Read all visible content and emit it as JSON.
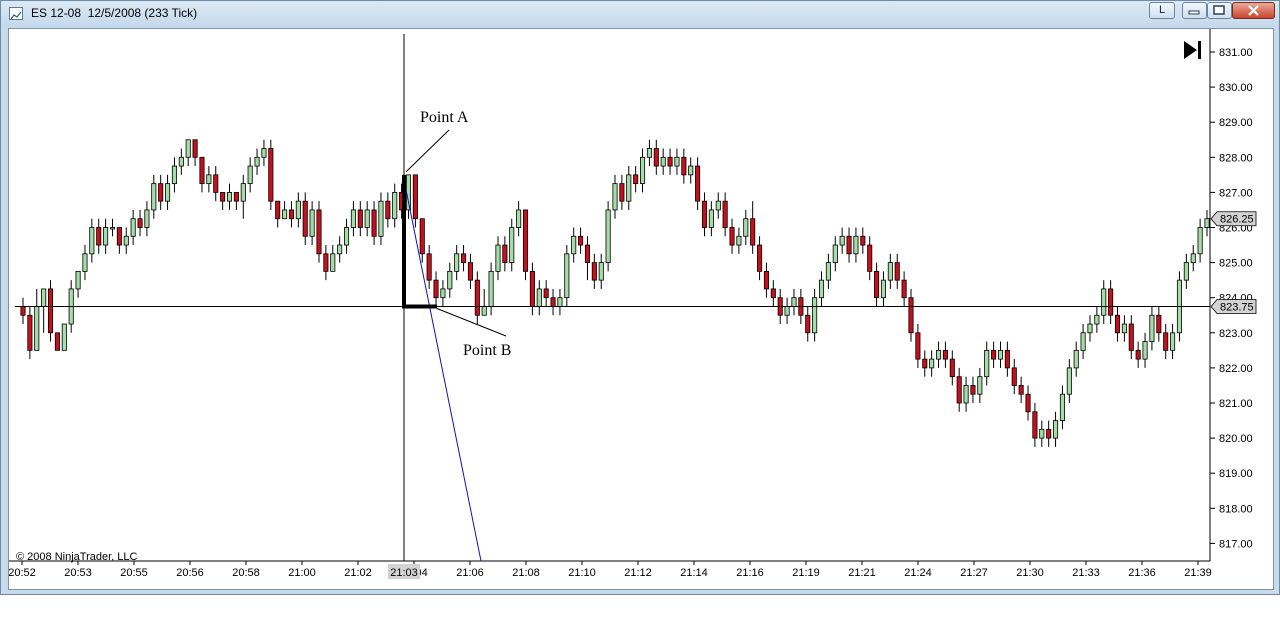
{
  "window": {
    "title": "ES 12-08  12/5/2008 (233 Tick)",
    "minimize_label": "L",
    "icons": [
      "chart-app-icon",
      "minimize-icon",
      "maximize-icon",
      "close-icon"
    ]
  },
  "chart": {
    "copyright": "© 2008 NinjaTrader, LLC",
    "scroll_end_icon": "skip-to-end-icon",
    "price_ticks": [
      "831.00",
      "830.00",
      "829.00",
      "828.00",
      "827.00",
      "826.00",
      "825.00",
      "824.00",
      "823.00",
      "822.00",
      "821.00",
      "820.00",
      "819.00",
      "818.00",
      "817.00"
    ],
    "time_ticks": [
      "20:52",
      "20:53",
      "20:55",
      "20:56",
      "20:58",
      "21:00",
      "21:02",
      "21:04",
      "21:06",
      "21:08",
      "21:10",
      "21:12",
      "21:14",
      "21:16",
      "21:19",
      "21:21",
      "21:24",
      "21:27",
      "21:30",
      "21:33",
      "21:36",
      "21:39"
    ],
    "last_price_label": "826.25",
    "crosshair_price_label": "823.75",
    "crosshair_time_label": "21:03",
    "annotations": {
      "point_a": "Point A",
      "point_b": "Point B"
    },
    "colors": {
      "up": "#a6dca6",
      "down": "#c8101c",
      "trendline": "#1010c0",
      "annotation_line": "#000000"
    }
  },
  "chart_data": {
    "type": "candlestick",
    "instrument": "ES 12-08",
    "ylim": [
      816.6,
      831.4
    ],
    "candles": [
      [
        823.75,
        823.5,
        824.0,
        823.25
      ],
      [
        823.5,
        822.5,
        823.75,
        822.25
      ],
      [
        822.5,
        823.75,
        824.25,
        822.5
      ],
      [
        823.75,
        824.25,
        824.25,
        823.0
      ],
      [
        824.25,
        823.0,
        824.5,
        822.75
      ],
      [
        823.0,
        822.5,
        823.0,
        822.5
      ],
      [
        822.5,
        823.25,
        823.25,
        822.5
      ],
      [
        823.25,
        824.25,
        824.5,
        823.0
      ],
      [
        824.25,
        824.75,
        824.75,
        824.0
      ],
      [
        824.75,
        825.25,
        825.5,
        824.5
      ],
      [
        825.25,
        826.0,
        826.25,
        825.0
      ],
      [
        826.0,
        825.5,
        826.25,
        825.25
      ],
      [
        825.5,
        826.0,
        826.25,
        825.25
      ],
      [
        826.0,
        826.0,
        826.25,
        825.75
      ],
      [
        826.0,
        825.5,
        826.0,
        825.25
      ],
      [
        825.5,
        825.75,
        826.0,
        825.25
      ],
      [
        825.75,
        826.25,
        826.5,
        825.5
      ],
      [
        826.25,
        826.0,
        826.5,
        825.75
      ],
      [
        826.0,
        826.5,
        826.75,
        825.75
      ],
      [
        826.5,
        827.25,
        827.5,
        826.25
      ],
      [
        827.25,
        826.75,
        827.5,
        826.5
      ],
      [
        826.75,
        827.25,
        827.5,
        826.5
      ],
      [
        827.25,
        827.75,
        828.0,
        827.0
      ],
      [
        827.75,
        828.0,
        828.25,
        827.5
      ],
      [
        828.0,
        828.5,
        828.5,
        827.75
      ],
      [
        828.5,
        828.0,
        828.5,
        827.75
      ],
      [
        828.0,
        827.25,
        828.0,
        827.0
      ],
      [
        827.25,
        827.5,
        827.75,
        827.0
      ],
      [
        827.5,
        827.0,
        827.75,
        826.75
      ],
      [
        827.0,
        826.75,
        827.0,
        826.5
      ],
      [
        826.75,
        827.0,
        827.25,
        826.5
      ],
      [
        827.0,
        826.75,
        827.0,
        826.5
      ],
      [
        826.75,
        827.25,
        827.5,
        826.25
      ],
      [
        827.25,
        827.75,
        828.0,
        827.0
      ],
      [
        827.75,
        828.0,
        828.25,
        827.5
      ],
      [
        828.0,
        828.25,
        828.5,
        827.75
      ],
      [
        828.25,
        826.75,
        828.5,
        826.5
      ],
      [
        826.75,
        826.25,
        826.75,
        826.0
      ],
      [
        826.25,
        826.5,
        826.75,
        826.25
      ],
      [
        826.5,
        826.25,
        826.75,
        826.0
      ],
      [
        826.25,
        826.75,
        827.0,
        826.0
      ],
      [
        826.75,
        825.75,
        827.0,
        825.5
      ],
      [
        825.75,
        826.5,
        826.75,
        825.5
      ],
      [
        826.5,
        825.25,
        826.75,
        825.0
      ],
      [
        825.25,
        824.75,
        825.5,
        824.5
      ],
      [
        824.75,
        825.25,
        825.5,
        824.75
      ],
      [
        825.25,
        825.5,
        825.75,
        825.0
      ],
      [
        825.5,
        826.0,
        826.25,
        825.25
      ],
      [
        826.0,
        826.5,
        826.75,
        825.75
      ],
      [
        826.5,
        826.0,
        826.75,
        825.75
      ],
      [
        826.0,
        826.5,
        826.75,
        825.75
      ],
      [
        826.5,
        825.75,
        826.75,
        825.5
      ],
      [
        825.75,
        826.75,
        827.0,
        825.5
      ],
      [
        826.75,
        826.25,
        827.0,
        826.0
      ],
      [
        826.25,
        827.0,
        827.25,
        826.0
      ],
      [
        827.0,
        826.5,
        827.25,
        826.25
      ],
      [
        826.5,
        827.5,
        827.5,
        826.25
      ],
      [
        827.5,
        826.25,
        827.5,
        826.0
      ],
      [
        826.25,
        825.25,
        826.25,
        825.0
      ],
      [
        825.25,
        824.5,
        825.5,
        824.25
      ],
      [
        824.5,
        824.0,
        824.75,
        823.75
      ],
      [
        824.0,
        824.25,
        824.5,
        823.75
      ],
      [
        824.25,
        824.75,
        825.0,
        824.0
      ],
      [
        824.75,
        825.25,
        825.5,
        824.5
      ],
      [
        825.25,
        825.0,
        825.5,
        824.75
      ],
      [
        825.0,
        824.5,
        825.25,
        824.25
      ],
      [
        824.5,
        823.5,
        824.75,
        823.25
      ],
      [
        823.5,
        823.75,
        824.25,
        823.5
      ],
      [
        823.75,
        824.75,
        825.0,
        823.5
      ],
      [
        824.75,
        825.5,
        825.75,
        824.5
      ],
      [
        825.5,
        825.0,
        825.75,
        824.75
      ],
      [
        825.0,
        826.0,
        826.25,
        824.75
      ],
      [
        826.0,
        826.5,
        826.75,
        825.75
      ],
      [
        826.5,
        824.75,
        826.5,
        824.5
      ],
      [
        824.75,
        823.75,
        825.0,
        823.5
      ],
      [
        823.75,
        824.25,
        824.5,
        823.5
      ],
      [
        824.25,
        824.0,
        824.5,
        823.75
      ],
      [
        824.0,
        823.75,
        824.25,
        823.5
      ],
      [
        823.75,
        824.0,
        824.25,
        823.5
      ],
      [
        824.0,
        825.25,
        825.5,
        823.75
      ],
      [
        825.25,
        825.75,
        826.0,
        825.0
      ],
      [
        825.75,
        825.5,
        826.0,
        825.25
      ],
      [
        825.5,
        825.0,
        825.75,
        824.5
      ],
      [
        825.0,
        824.5,
        825.25,
        824.25
      ],
      [
        824.5,
        825.0,
        825.25,
        824.25
      ],
      [
        825.0,
        826.5,
        826.75,
        824.75
      ],
      [
        826.5,
        827.25,
        827.5,
        826.25
      ],
      [
        827.25,
        826.75,
        827.5,
        826.5
      ],
      [
        826.75,
        827.5,
        827.75,
        826.5
      ],
      [
        827.5,
        827.25,
        827.75,
        827.0
      ],
      [
        827.25,
        828.0,
        828.25,
        827.0
      ],
      [
        828.0,
        828.25,
        828.5,
        827.75
      ],
      [
        828.25,
        827.75,
        828.5,
        827.5
      ],
      [
        827.75,
        828.0,
        828.25,
        827.5
      ],
      [
        828.0,
        827.75,
        828.25,
        827.5
      ],
      [
        827.75,
        828.0,
        828.25,
        827.5
      ],
      [
        828.0,
        827.5,
        828.25,
        827.25
      ],
      [
        827.5,
        827.75,
        828.0,
        827.25
      ],
      [
        827.75,
        826.75,
        828.0,
        826.5
      ],
      [
        826.75,
        826.0,
        827.0,
        825.75
      ],
      [
        826.0,
        826.5,
        826.75,
        825.75
      ],
      [
        826.5,
        826.75,
        827.0,
        826.25
      ],
      [
        826.75,
        826.0,
        827.0,
        825.75
      ],
      [
        826.0,
        825.5,
        826.25,
        825.25
      ],
      [
        825.5,
        825.75,
        826.0,
        825.25
      ],
      [
        825.75,
        826.25,
        826.5,
        825.5
      ],
      [
        826.25,
        825.5,
        826.75,
        825.25
      ],
      [
        825.5,
        824.75,
        825.75,
        824.5
      ],
      [
        824.75,
        824.25,
        825.0,
        824.0
      ],
      [
        824.25,
        824.0,
        824.5,
        823.75
      ],
      [
        824.0,
        823.5,
        824.25,
        823.25
      ],
      [
        823.5,
        823.75,
        824.0,
        823.25
      ],
      [
        823.75,
        824.0,
        824.25,
        823.5
      ],
      [
        824.0,
        823.5,
        824.25,
        823.25
      ],
      [
        823.5,
        823.0,
        823.75,
        822.75
      ],
      [
        823.0,
        824.0,
        824.25,
        822.75
      ],
      [
        824.0,
        824.5,
        824.75,
        823.75
      ],
      [
        824.5,
        825.0,
        825.25,
        824.25
      ],
      [
        825.0,
        825.5,
        825.75,
        824.75
      ],
      [
        825.5,
        825.75,
        826.0,
        825.25
      ],
      [
        825.75,
        825.25,
        826.0,
        825.0
      ],
      [
        825.25,
        825.75,
        826.0,
        825.0
      ],
      [
        825.75,
        825.5,
        826.0,
        825.25
      ],
      [
        825.5,
        824.75,
        825.75,
        824.5
      ],
      [
        824.75,
        824.0,
        825.0,
        823.75
      ],
      [
        824.0,
        824.5,
        824.75,
        823.75
      ],
      [
        824.5,
        825.0,
        825.25,
        824.25
      ],
      [
        825.0,
        824.5,
        825.25,
        824.25
      ],
      [
        824.5,
        824.0,
        824.75,
        823.75
      ],
      [
        824.0,
        823.0,
        824.25,
        822.75
      ],
      [
        823.0,
        822.25,
        823.25,
        822.0
      ],
      [
        822.25,
        822.0,
        822.5,
        821.75
      ],
      [
        822.0,
        822.25,
        822.5,
        821.75
      ],
      [
        822.25,
        822.5,
        822.75,
        822.0
      ],
      [
        822.5,
        822.25,
        822.75,
        822.0
      ],
      [
        822.25,
        821.75,
        822.5,
        821.5
      ],
      [
        821.75,
        821.0,
        822.0,
        820.75
      ],
      [
        821.0,
        821.5,
        821.75,
        820.75
      ],
      [
        821.5,
        821.25,
        821.75,
        821.0
      ],
      [
        821.25,
        821.75,
        822.0,
        821.0
      ],
      [
        821.75,
        822.5,
        822.75,
        821.5
      ],
      [
        822.5,
        822.25,
        822.75,
        822.0
      ],
      [
        822.25,
        822.5,
        822.75,
        822.0
      ],
      [
        822.5,
        822.0,
        822.75,
        821.75
      ],
      [
        822.0,
        821.5,
        822.25,
        821.25
      ],
      [
        821.5,
        821.25,
        821.75,
        821.0
      ],
      [
        821.25,
        820.75,
        821.5,
        820.5
      ],
      [
        820.75,
        820.0,
        821.0,
        819.75
      ],
      [
        820.0,
        820.25,
        820.5,
        819.75
      ],
      [
        820.25,
        820.0,
        820.5,
        819.75
      ],
      [
        820.0,
        820.5,
        820.75,
        819.75
      ],
      [
        820.5,
        821.25,
        821.5,
        820.25
      ],
      [
        821.25,
        822.0,
        822.25,
        821.0
      ],
      [
        822.0,
        822.5,
        822.75,
        821.75
      ],
      [
        822.5,
        823.0,
        823.25,
        822.25
      ],
      [
        823.0,
        823.25,
        823.5,
        822.75
      ],
      [
        823.25,
        823.5,
        823.75,
        823.0
      ],
      [
        823.5,
        824.25,
        824.5,
        823.25
      ],
      [
        824.25,
        823.5,
        824.5,
        823.25
      ],
      [
        823.5,
        823.0,
        823.75,
        822.75
      ],
      [
        823.0,
        823.25,
        823.5,
        822.75
      ],
      [
        823.25,
        822.5,
        823.5,
        822.25
      ],
      [
        822.5,
        822.25,
        822.75,
        822.0
      ],
      [
        822.25,
        822.75,
        823.0,
        822.0
      ],
      [
        822.75,
        823.5,
        823.75,
        822.5
      ],
      [
        823.5,
        823.0,
        823.75,
        822.75
      ],
      [
        823.0,
        822.5,
        823.25,
        822.25
      ],
      [
        822.5,
        823.0,
        823.25,
        822.25
      ],
      [
        823.0,
        824.5,
        824.75,
        822.75
      ],
      [
        824.5,
        825.0,
        825.25,
        824.25
      ],
      [
        825.0,
        825.25,
        825.5,
        824.75
      ],
      [
        825.25,
        826.0,
        826.25,
        825.0
      ],
      [
        826.0,
        826.25,
        826.5,
        825.75
      ]
    ],
    "candle_fields": [
      "open",
      "close",
      "high",
      "low"
    ],
    "horizontal_line": 823.75,
    "vertical_line_time": "21:03",
    "annotation_points": {
      "point_a_price": 827.5,
      "point_b_price": 823.75
    }
  }
}
